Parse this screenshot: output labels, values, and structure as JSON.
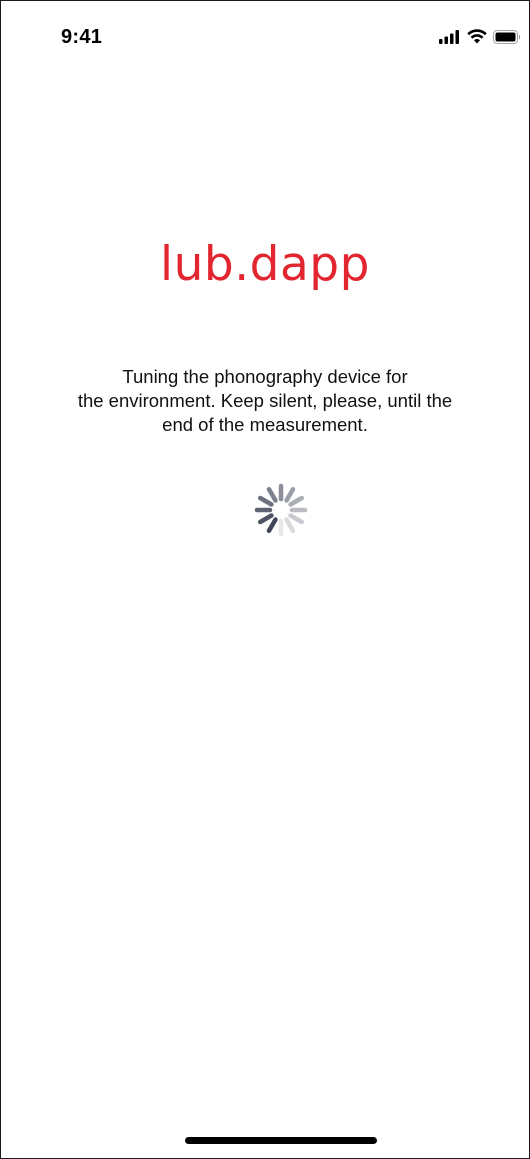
{
  "status_bar": {
    "time": "9:41",
    "icons": [
      "cellular-signal-icon",
      "wifi-icon",
      "battery-icon"
    ]
  },
  "app": {
    "logo_text": "lub.dapp",
    "brand_color": "#e2262f"
  },
  "message": {
    "lines": [
      "Tuning the phonography device for",
      "the environment. Keep silent, please, until the",
      "end of the measurement."
    ]
  },
  "loading": {
    "indicator": "activity-spinner-icon"
  }
}
